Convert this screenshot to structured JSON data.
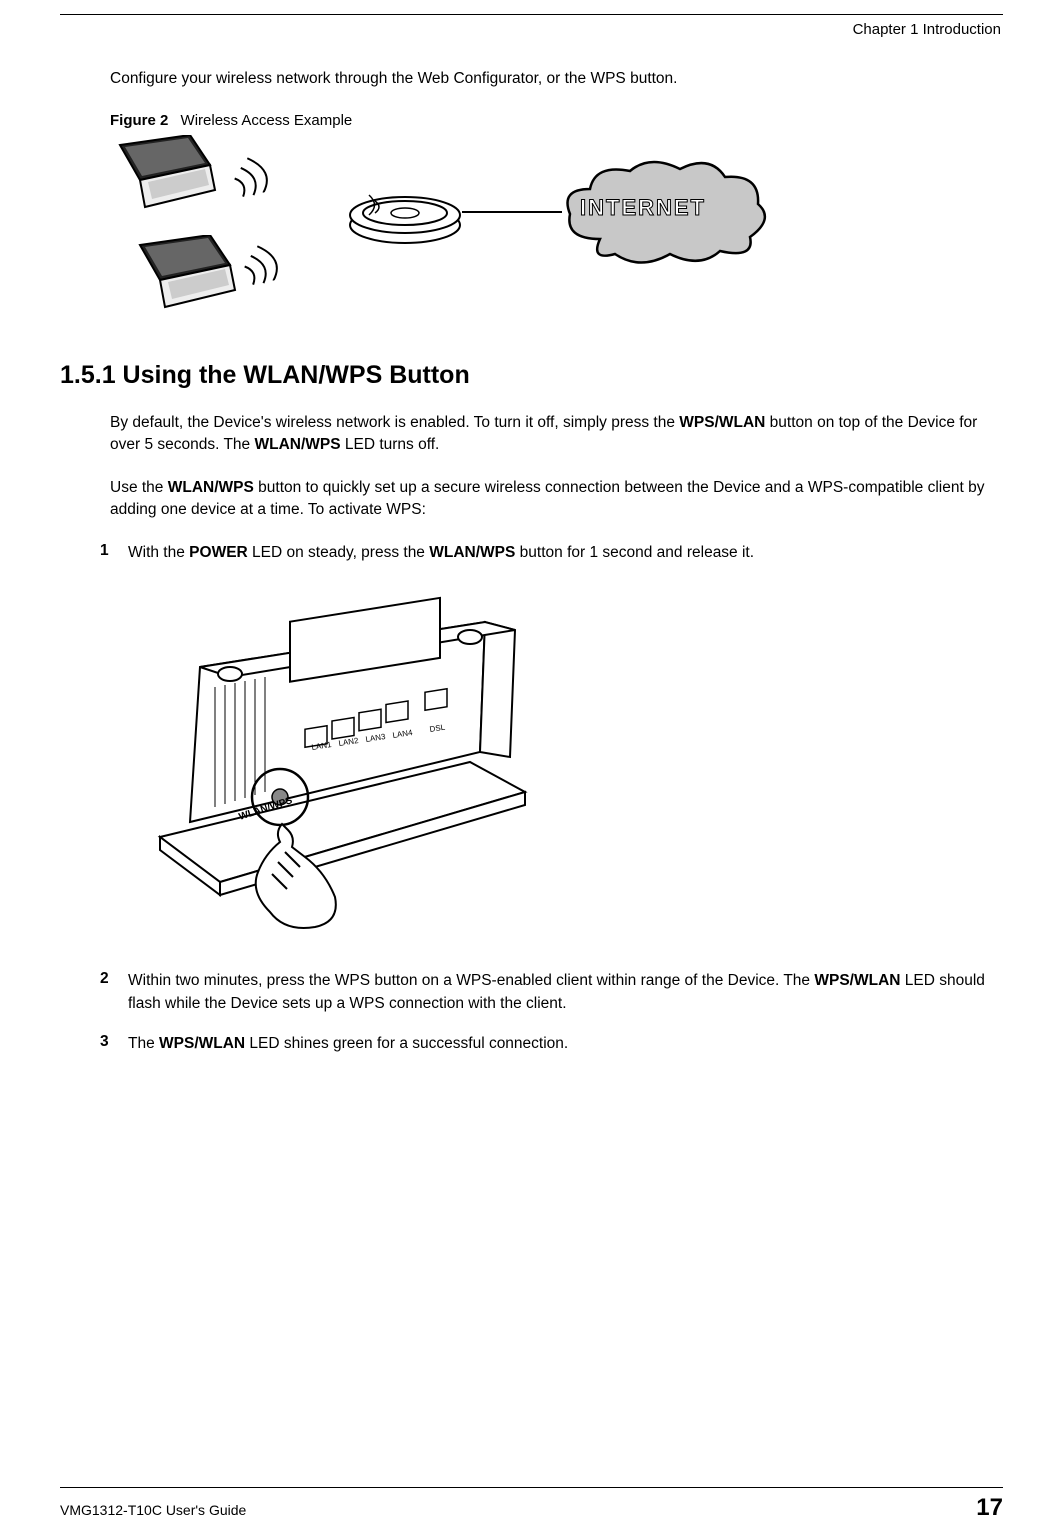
{
  "header": {
    "chapter_label": "Chapter 1 Introduction"
  },
  "intro": "Configure your wireless network through the Web Configurator, or the WPS button.",
  "figure": {
    "label_bold": "Figure 2",
    "label_rest": "Wireless Access Example",
    "cloud_text": "INTERNET"
  },
  "section": {
    "heading": "1.5.1  Using the WLAN/WPS Button",
    "para1_pre": "By default, the Device's wireless network is enabled. To turn it off, simply press the ",
    "para1_b1": "WPS/WLAN",
    "para1_mid": " button on top of the Device for over 5 seconds. The ",
    "para1_b2": "WLAN/WPS",
    "para1_post": " LED turns off.",
    "para2_pre": "Use the ",
    "para2_b1": "WLAN/WPS",
    "para2_post": " button to quickly set up a secure wireless connection between the Device and a WPS-compatible client by adding one device at a time. To activate WPS:"
  },
  "steps": [
    {
      "num": "1",
      "t1": "With the ",
      "b1": "POWER",
      "t2": " LED on steady, press the ",
      "b2": "WLAN/WPS",
      "t3": " button for 1 second and release it."
    },
    {
      "num": "2",
      "t1": "Within two minutes, press the WPS button on a WPS-enabled client within range of the Device. The ",
      "b1": "WPS/WLAN",
      "t2": " LED should flash while the Device sets up a WPS connection with the client.",
      "b2": "",
      "t3": ""
    },
    {
      "num": "3",
      "t1": "The ",
      "b1": "WPS/WLAN",
      "t2": " LED shines green for a successful connection.",
      "b2": "",
      "t3": ""
    }
  ],
  "footer": {
    "guide_name": "VMG1312-T10C User's Guide",
    "page_number": "17"
  }
}
